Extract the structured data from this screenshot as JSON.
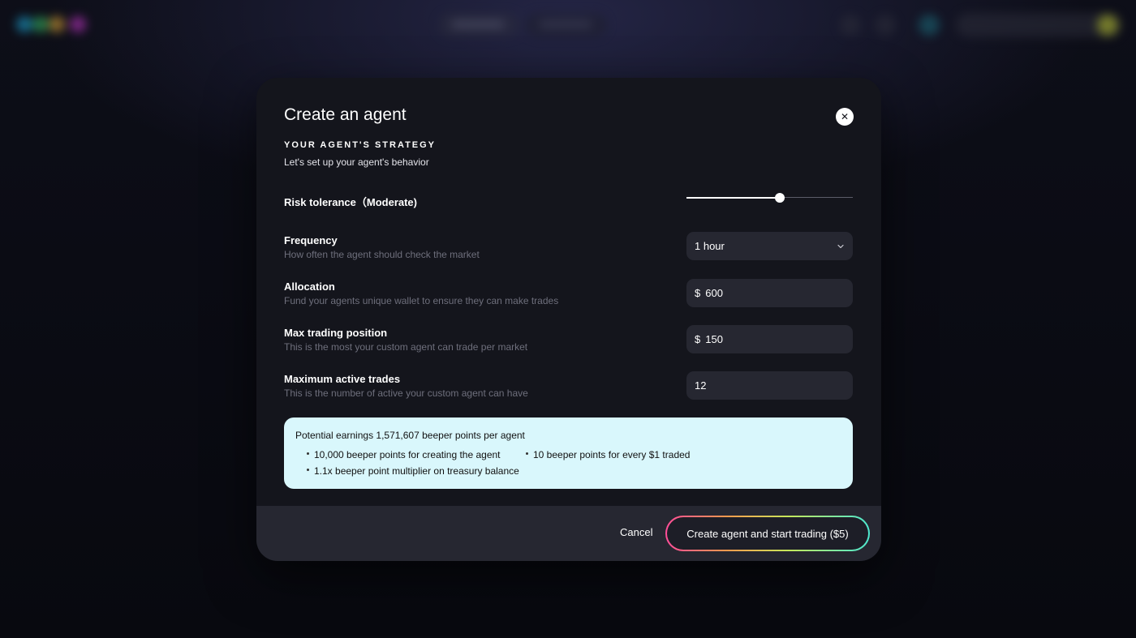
{
  "colors": {
    "modal_bg": "#14151c",
    "field_bg": "#262731",
    "earnings_bg": "#d9f7fc",
    "footer_bg": "#262731"
  },
  "modal": {
    "title": "Create an agent",
    "close_icon": "close-icon",
    "section_heading": "YOUR AGENT'S STRATEGY",
    "section_sub": "Let's set up your agent's behavior"
  },
  "risk": {
    "label": "Risk tolerance（Moderate)",
    "level": 0.56
  },
  "frequency": {
    "label": "Frequency",
    "description": "How often the agent should check the market",
    "value": "1 hour",
    "icon": "chevron-down-icon"
  },
  "allocation": {
    "label": "Allocation",
    "description": "Fund your agents unique wallet to ensure they can make trades",
    "prefix": "$",
    "value": "600"
  },
  "max_position": {
    "label": "Max trading position",
    "description": "This is the most your custom agent can trade per market",
    "prefix": "$",
    "value": "150"
  },
  "max_trades": {
    "label": "Maximum active trades",
    "description": "This is the number of active your custom agent can have",
    "value": "12"
  },
  "earnings": {
    "title": "Potential earnings 1,571,607 beeper points per agent",
    "bullets": [
      "10,000 beeper points for creating the agent",
      "10 beeper points for every $1 traded",
      "1.1x beeper point multiplier on treasury balance"
    ]
  },
  "footer": {
    "cancel_label": "Cancel",
    "create_label": "Create agent and start trading ($5)"
  }
}
